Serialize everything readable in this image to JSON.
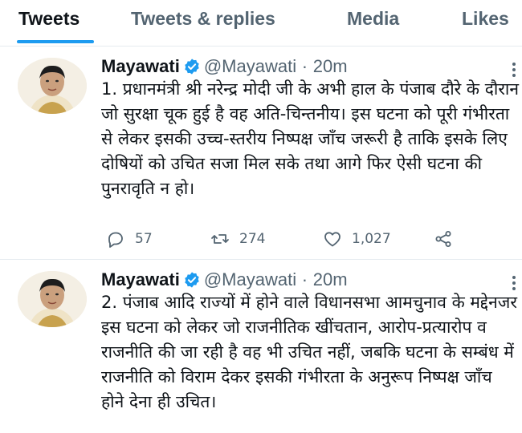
{
  "tabs": [
    "Tweets",
    "Tweets & replies",
    "Media",
    "Likes"
  ],
  "accent_color": "#1d9bf0",
  "tweets": [
    {
      "name": "Mayawati",
      "handle": "@Mayawati",
      "separator": "·",
      "time": "20m",
      "text": "1. प्रधानमंत्री श्री नरेन्द्र मोदी जी के अभी हाल के पंजाब दौरे के दौरान जो सुरक्षा चूक हुई है वह अति-चिन्तनीय। इस घटना को पूरी गंभीरता से लेकर इसकी उच्च-स्तरीय निष्पक्ष जाँच जरूरी है ताकि इसके लिए दोषियों को उचित सजा मिल सके तथा आगे फिर ऐसी घटना की पुनरावृति न हो।",
      "replies": "57",
      "retweets": "274",
      "likes": "1,027"
    },
    {
      "name": "Mayawati",
      "handle": "@Mayawati",
      "separator": "·",
      "time": "20m",
      "text": "2. पंजाब आदि राज्यों में होने वाले विधानसभा आमचुनाव के मद्देनजर इस घटना को लेकर जो राजनीतिक खींचतान, आरोप-प्रत्यारोप व राजनीति की जा रही है वह भी उचित नहीं, जबकि घटना के सम्बंध में राजनीति को विराम देकर इसकी गंभीरता के अनुरूप निष्पक्ष जाँच होने देना ही उचित।"
    }
  ],
  "icons": [
    "verified-badge-icon",
    "reply-icon",
    "retweet-icon",
    "like-icon",
    "share-icon",
    "more-icon"
  ]
}
